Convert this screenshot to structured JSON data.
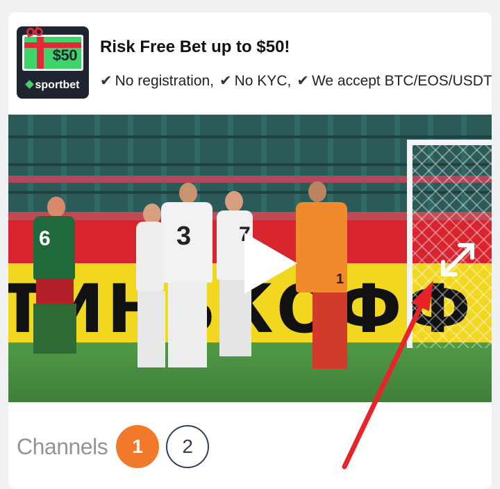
{
  "promo": {
    "logo_price": "$50",
    "logo_brand": "sportbet",
    "title": "Risk Free Bet up to $50!",
    "features": [
      "No registration,",
      "No KYC,",
      "We accept BTC/EOS/USDT"
    ],
    "check_glyph": "✔"
  },
  "video": {
    "ad_board_text": "ТИНЬКОФФ",
    "player_numbers": [
      "6",
      "3",
      "7",
      "1"
    ],
    "play_icon": "play-icon",
    "fullscreen_icon": "fullscreen-expand-icon"
  },
  "annotation": {
    "arrow_color": "#e8232a"
  },
  "channels": {
    "label": "Channels",
    "items": [
      {
        "label": "1",
        "active": true
      },
      {
        "label": "2",
        "active": false
      }
    ],
    "accent": "#f07a2a"
  }
}
